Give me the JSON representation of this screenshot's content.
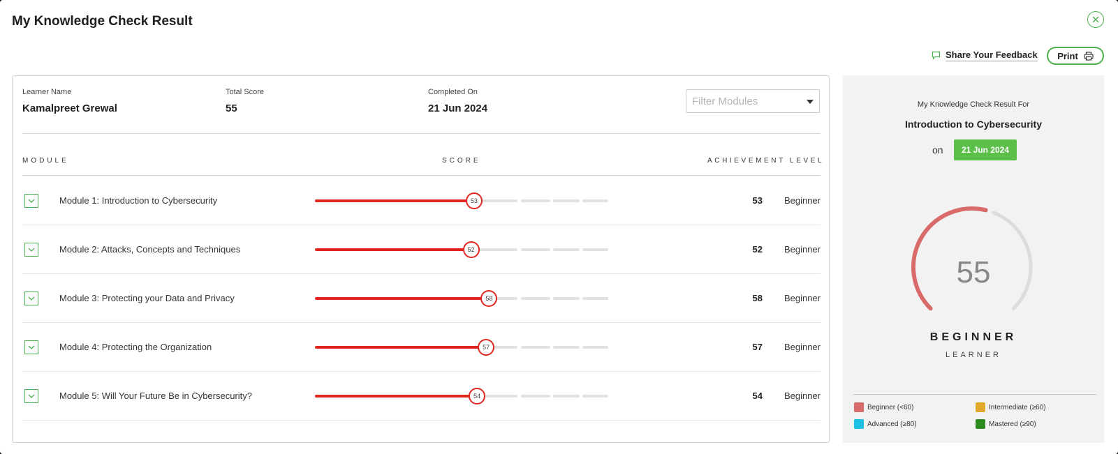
{
  "dialog": {
    "title": "My Knowledge Check Result"
  },
  "toolbar": {
    "feedback_label": "Share Your Feedback",
    "print_label": "Print"
  },
  "summary": {
    "learner_label": "Learner Name",
    "learner_value": "Kamalpreet Grewal",
    "score_label": "Total Score",
    "score_value": "55",
    "completed_label": "Completed On",
    "completed_value": "21 Jun 2024"
  },
  "filter": {
    "placeholder": "Filter Modules"
  },
  "table": {
    "headers": {
      "module": "MODULE",
      "score": "SCORE",
      "level": "ACHIEVEMENT LEVEL"
    },
    "rows": [
      {
        "name": "Module 1: Introduction to Cybersecurity",
        "score": "53",
        "level": "Beginner"
      },
      {
        "name": "Module 2: Attacks, Concepts and Techniques",
        "score": "52",
        "level": "Beginner"
      },
      {
        "name": "Module 3: Protecting your Data and Privacy",
        "score": "58",
        "level": "Beginner"
      },
      {
        "name": "Module 4: Protecting the Organization",
        "score": "57",
        "level": "Beginner"
      },
      {
        "name": "Module 5: Will Your Future Be in Cybersecurity?",
        "score": "54",
        "level": "Beginner"
      }
    ]
  },
  "result": {
    "caption": "My Knowledge Check Result For",
    "course": "Introduction to Cybersecurity",
    "on_label": "on",
    "date": "21 Jun 2024",
    "score": "55",
    "level": "BEGINNER",
    "sub": "LEARNER"
  },
  "legend": [
    {
      "label": "Beginner (<60)",
      "color": "#d96a6a"
    },
    {
      "label": "Intermediate (≥60)",
      "color": "#e0a82a"
    },
    {
      "label": "Advanced (≥80)",
      "color": "#1ec0e6"
    },
    {
      "label": "Mastered (≥90)",
      "color": "#2e8b22"
    }
  ],
  "colors": {
    "accent": "#4caf50",
    "bar_fill": "#e0261e",
    "date_badge": "#5cbf4a",
    "gauge_arc": "#d96a6a",
    "gauge_track": "#dcdcdc"
  }
}
